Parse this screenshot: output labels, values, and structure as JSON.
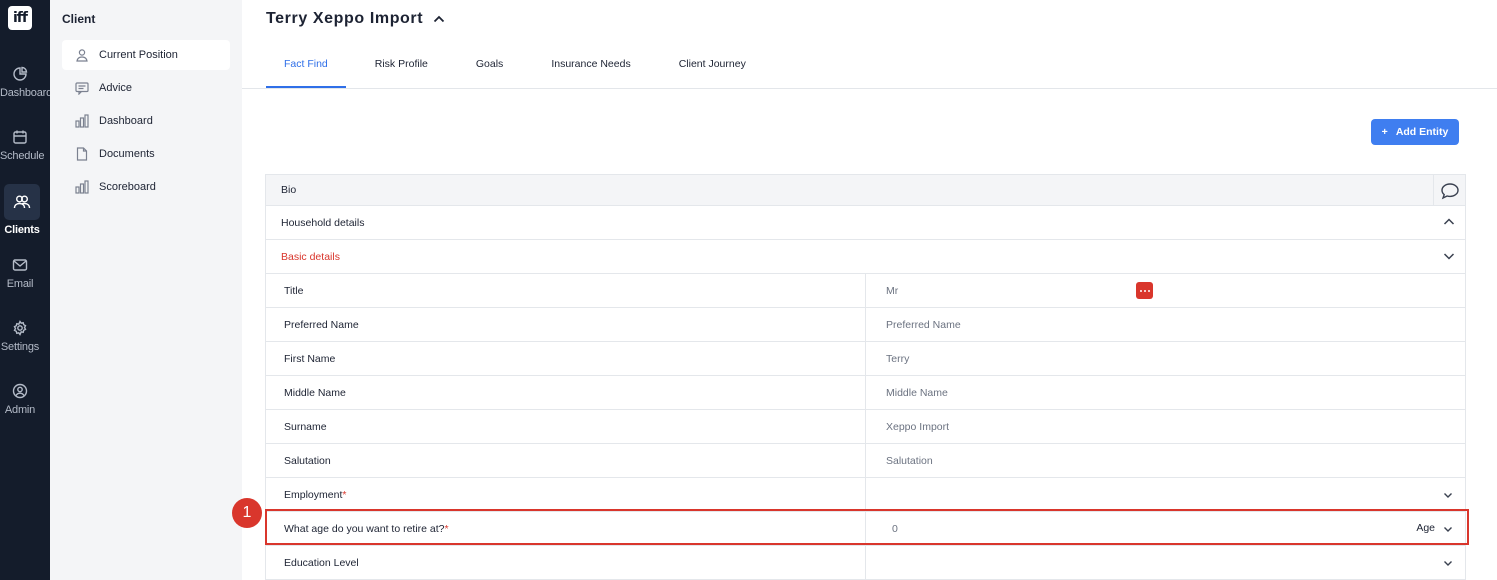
{
  "rail": {
    "logo": "iff",
    "items": [
      {
        "label": "Dashboard",
        "icon": "pie-chart-icon"
      },
      {
        "label": "Schedule",
        "icon": "calendar-icon"
      },
      {
        "label": "Clients",
        "icon": "users-icon",
        "active": true
      },
      {
        "label": "Email",
        "icon": "mail-icon"
      },
      {
        "label": "Settings",
        "icon": "gear-icon"
      },
      {
        "label": "Admin",
        "icon": "user-circle-icon"
      }
    ]
  },
  "sidebar": {
    "title": "Client",
    "items": [
      {
        "label": "Current Position",
        "icon": "person-icon",
        "active": true
      },
      {
        "label": "Advice",
        "icon": "message-icon"
      },
      {
        "label": "Dashboard",
        "icon": "bar-chart-icon"
      },
      {
        "label": "Documents",
        "icon": "document-icon"
      },
      {
        "label": "Scoreboard",
        "icon": "bar-chart-icon"
      }
    ]
  },
  "header": {
    "title": "Terry Xeppo Import"
  },
  "tabs": [
    {
      "label": "Fact Find",
      "active": true
    },
    {
      "label": "Risk Profile"
    },
    {
      "label": "Goals"
    },
    {
      "label": "Insurance Needs"
    },
    {
      "label": "Client Journey"
    }
  ],
  "actions": {
    "add_entity": "Add Entity"
  },
  "panel": {
    "bio": "Bio",
    "household": "Household details",
    "basic": "Basic details",
    "rows": [
      {
        "label": "Title",
        "value": "Mr"
      },
      {
        "label": "Preferred Name",
        "value": "Preferred Name"
      },
      {
        "label": "First Name",
        "value": "Terry"
      },
      {
        "label": "Middle Name",
        "value": "Middle Name"
      },
      {
        "label": "Surname",
        "value": "Xeppo Import"
      },
      {
        "label": "Salutation",
        "value": "Salutation"
      },
      {
        "label": "Employment",
        "required": "*",
        "value": ""
      },
      {
        "label": "What age do you want to retire at?",
        "required": "*",
        "value": "0",
        "unit": "Age"
      },
      {
        "label": "Education Level",
        "value": ""
      }
    ]
  },
  "annotation": {
    "step": "1"
  },
  "colors": {
    "accent": "#3f7ef0",
    "rail": "#141c2b",
    "danger": "#d9362c"
  }
}
